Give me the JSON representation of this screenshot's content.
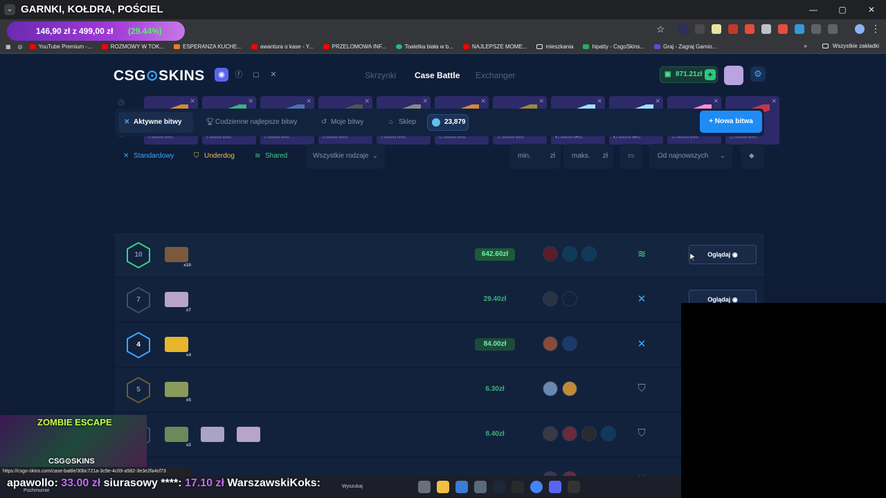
{
  "stream": {
    "title": "GARNKI, KOŁDRA, POŚCIEL",
    "banner_price": "146,90 zł z 499,00 zł",
    "banner_pct": "(29.44%)",
    "ticker": [
      {
        "name": "apawollo:",
        "amount": "33.00 zł"
      },
      {
        "name": "siurasowy ****:",
        "amount": "17.10 zł"
      },
      {
        "name": "WarszawskiKoks:",
        "amount": ""
      }
    ],
    "cam_title": "ZOMBIE ESCAPE",
    "cam_logo": "CSG⊙SKINS"
  },
  "browser": {
    "window_controls": [
      "—",
      "▢",
      "✕"
    ],
    "bookmarks": [
      "YouTube Premium -...",
      "ROZMOWY W TOK...",
      "ESPERANZA KUCHE...",
      "awantura o kase - Y...",
      "PRZELOMOWA INF...",
      "Toaletka biała w b...",
      "NAJLEPSZE MOME...",
      "mieszkania",
      "hipatty - CsgoSkins...",
      "Graj - Zagraj Gamio..."
    ],
    "bookmarks_more": "»",
    "all_bookmarks": "Wszystkie zakładki",
    "status_url": "https://csgo-skins.com/case-battle/30bc721a-3c9e-4c09-a582-3e3e2fa4cf73",
    "taskbar_weather": "Pochmurnie",
    "taskbar_search": "Wyszukaj"
  },
  "site": {
    "logo_left": "CSG",
    "logo_mid": "⊙",
    "logo_right": "SKINS",
    "nav": [
      "Skrzynki",
      "Case Battle",
      "Exchanger"
    ],
    "balance": "871.21zł",
    "drops": [
      {
        "name": "WEASEL",
        "time": "5 sekund temu",
        "color": "#d08a3a"
      },
      {
        "name": "EMBARGO",
        "time": "5 sekund temu",
        "color": "#3fae82"
      },
      {
        "name": "ROYAL GUARD",
        "time": "5 sekund temu",
        "color": "#4b6fb2"
      },
      {
        "name": "ENFORCER",
        "time": "9 sekund temu",
        "color": "#545454"
      },
      {
        "name": "FEVER DREAM",
        "time": "9 sekund temu",
        "color": "#8a8a8a"
      },
      {
        "name": "WEASEL",
        "time": "11 sekund temu",
        "color": "#d08a3a"
      },
      {
        "name": "FLASHBACK",
        "time": "12 sekund temu",
        "color": "#9a8c3a"
      },
      {
        "name": "KAWAII EYES (GLITTER)",
        "time": "12 sekund temu",
        "color": "#9fe0ff"
      },
      {
        "name": "KAWAII EYES (GLITTER)",
        "time": "12 sekund temu",
        "color": "#9fe0ff"
      },
      {
        "name": "TASTE BUDDY (HOLO)",
        "time": "12 sekund temu",
        "color": "#ff8fd0"
      },
      {
        "name": "HEMOGLOBIN",
        "time": "12 sekund temu",
        "color": "#c8344a"
      }
    ],
    "tabs": [
      "Aktywne bitwy",
      "Codzienne najlepsze bitwy",
      "Moje bitwy",
      "Sklep"
    ],
    "coins": "23,879",
    "new_battle": "+ Nowa bitwa",
    "modes": [
      "Standardowy",
      "Underdog",
      "Shared"
    ],
    "type_select": "Wszystkie rodzaje",
    "min_placeholder": "min.",
    "max_placeholder": "maks.",
    "currency": "zł",
    "sort_select": "Od najnowszych",
    "watch_label": "Oglądaj",
    "rows": [
      {
        "rounds": "10",
        "hex_color": "#3fd08a",
        "cases": [
          {
            "count": "x10",
            "color": "#7a5a3a"
          }
        ],
        "price": "642.60zł",
        "price_bg": "#1d5a3a",
        "price_color": "#6ff0a6",
        "players": [
          "#5a1d2a",
          "#0f3a5a",
          "#0f3a5a"
        ],
        "mode": "≋",
        "mode_color": "#3fd08a",
        "watch": true
      },
      {
        "rounds": "7",
        "hex_color": "#3a4e70",
        "cases": [
          {
            "count": "x7",
            "color": "#b7a4c7"
          }
        ],
        "price": "29.40zł",
        "price_bg": "transparent",
        "price_color": "#3fb07a",
        "players": [
          "#2a3344",
          "#12223d"
        ],
        "mode": "✕",
        "mode_color": "#3ea7ff",
        "watch": true
      },
      {
        "rounds": "4",
        "hex_color": "#3ea7ff",
        "cases": [
          {
            "count": "x4",
            "color": "#e7b52a"
          }
        ],
        "price": "84.00zł",
        "price_bg": "#1d4a3a",
        "price_color": "#6ff0a6",
        "players": [
          "#8a4a3a",
          "#1c3a6a"
        ],
        "mode": "✕",
        "mode_color": "#3ea7ff",
        "watch": false
      },
      {
        "rounds": "5",
        "hex_color": "#6a5a3a",
        "cases": [
          {
            "count": "x5",
            "color": "#8a9a5a"
          }
        ],
        "price": "6.30zł",
        "price_bg": "transparent",
        "price_color": "#3fb07a",
        "players": [
          "#6a88b0",
          "#c08a3a"
        ],
        "mode": "⛉",
        "mode_color": "#7a879e",
        "watch": false
      },
      {
        "rounds": "",
        "hex_color": "#3a4e70",
        "cases": [
          {
            "count": "x2",
            "color": "#6a8a5a"
          },
          {
            "count": "",
            "color": "#a9a4c7"
          },
          {
            "count": "",
            "color": "#b7a4c7"
          }
        ],
        "price": "8.40zł",
        "price_bg": "transparent",
        "price_color": "#3fb07a",
        "players": [
          "#3a3a44",
          "#6a2a3a",
          "#2a2a2a",
          "#0f3a5a"
        ],
        "mode": "⛉",
        "mode_color": "#7a879e",
        "watch": false
      },
      {
        "rounds": "",
        "hex_color": "#3a4e70",
        "cases": [],
        "price": "",
        "price_bg": "transparent",
        "price_color": "#3fb07a",
        "players": [
          "#3a3a44",
          "#6a2a3a"
        ],
        "mode": "✕",
        "mode_color": "#3ea7ff",
        "watch": false
      }
    ]
  }
}
